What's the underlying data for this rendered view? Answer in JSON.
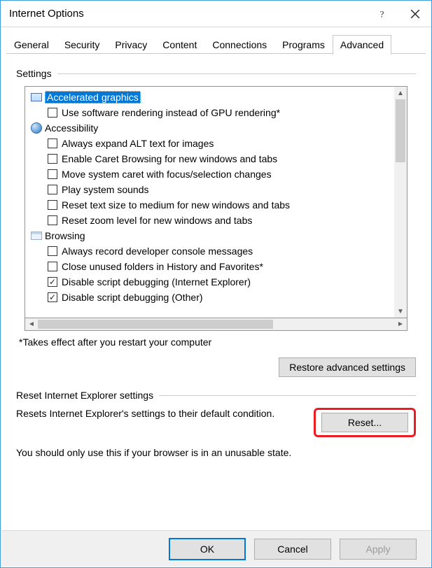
{
  "titlebar": {
    "title": "Internet Options"
  },
  "tabs": {
    "items": [
      "General",
      "Security",
      "Privacy",
      "Content",
      "Connections",
      "Programs",
      "Advanced"
    ],
    "active_index": 6
  },
  "settings": {
    "heading": "Settings",
    "tree": [
      {
        "type": "category",
        "icon": "monitor",
        "label": "Accelerated graphics",
        "selected": true
      },
      {
        "type": "checkbox",
        "indent": 1,
        "checked": false,
        "label": "Use software rendering instead of GPU rendering*"
      },
      {
        "type": "category",
        "icon": "globe",
        "label": "Accessibility"
      },
      {
        "type": "checkbox",
        "indent": 1,
        "checked": false,
        "label": "Always expand ALT text for images"
      },
      {
        "type": "checkbox",
        "indent": 1,
        "checked": false,
        "label": "Enable Caret Browsing for new windows and tabs"
      },
      {
        "type": "checkbox",
        "indent": 1,
        "checked": false,
        "label": "Move system caret with focus/selection changes"
      },
      {
        "type": "checkbox",
        "indent": 1,
        "checked": false,
        "label": "Play system sounds"
      },
      {
        "type": "checkbox",
        "indent": 1,
        "checked": false,
        "label": "Reset text size to medium for new windows and tabs"
      },
      {
        "type": "checkbox",
        "indent": 1,
        "checked": false,
        "label": "Reset zoom level for new windows and tabs"
      },
      {
        "type": "category",
        "icon": "window",
        "label": "Browsing"
      },
      {
        "type": "checkbox",
        "indent": 1,
        "checked": false,
        "label": "Always record developer console messages"
      },
      {
        "type": "checkbox",
        "indent": 1,
        "checked": false,
        "label": "Close unused folders in History and Favorites*"
      },
      {
        "type": "checkbox",
        "indent": 1,
        "checked": true,
        "label": "Disable script debugging (Internet Explorer)"
      },
      {
        "type": "checkbox",
        "indent": 1,
        "checked": true,
        "label": "Disable script debugging (Other)"
      }
    ],
    "footnote": "*Takes effect after you restart your computer",
    "restore_button": "Restore advanced settings"
  },
  "reset": {
    "heading": "Reset Internet Explorer settings",
    "description": "Resets Internet Explorer's settings to their default condition.",
    "button": "Reset...",
    "warning": "You should only use this if your browser is in an unusable state."
  },
  "dialog_buttons": {
    "ok": "OK",
    "cancel": "Cancel",
    "apply": "Apply"
  }
}
